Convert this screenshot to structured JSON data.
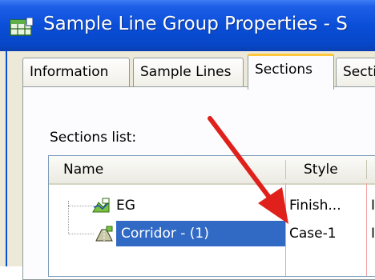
{
  "window": {
    "title": "Sample Line Group Properties - S"
  },
  "tabs": [
    {
      "label": "Information"
    },
    {
      "label": "Sample Lines"
    },
    {
      "label": "Sections"
    },
    {
      "label": "Secti"
    }
  ],
  "sections": {
    "label": "Sections list:",
    "columns": {
      "name": "Name",
      "style": "Style"
    },
    "rows": [
      {
        "name": "EG",
        "style": "Finish...",
        "extra": "I"
      },
      {
        "name": "Corridor - (1)",
        "style": "Case-1",
        "extra": "I"
      }
    ]
  },
  "colors": {
    "titlebar": "#0a4ed8",
    "selection": "#316ac5",
    "arrow": "#e0201a",
    "active_tab_accent": "#ffc83c"
  },
  "icons": {
    "app": "table-properties-icon",
    "eg": "surface-icon",
    "corridor": "corridor-icon",
    "annotation": "red-arrow"
  }
}
